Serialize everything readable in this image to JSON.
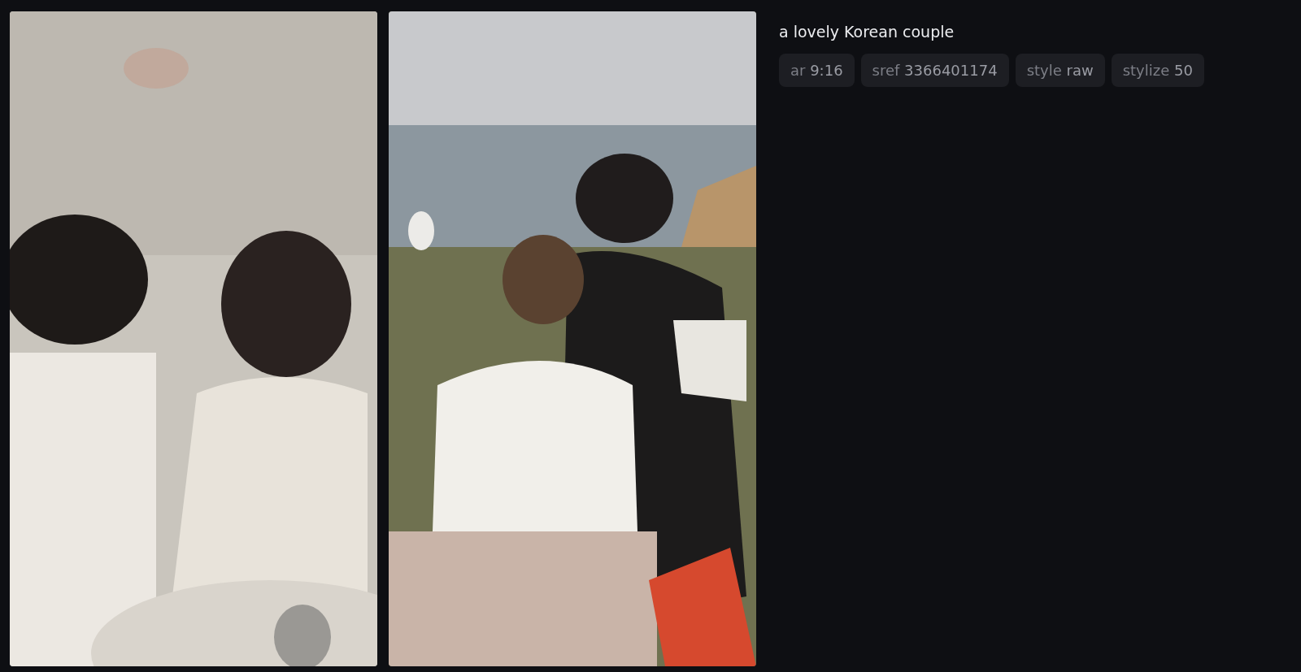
{
  "prompt": "a lovely Korean couple",
  "parameters": [
    {
      "key": "ar",
      "value": "9:16"
    },
    {
      "key": "sref",
      "value": "3366401174"
    },
    {
      "key": "style",
      "value": "raw"
    },
    {
      "key": "stylize",
      "value": "50"
    }
  ]
}
